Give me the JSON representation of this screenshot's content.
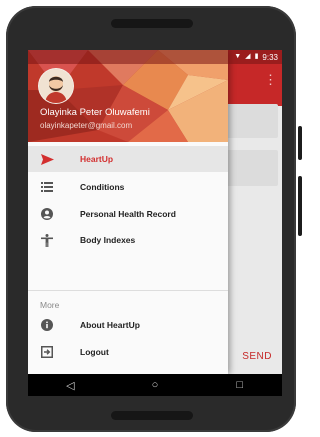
{
  "status_bar": {
    "time": "9:33"
  },
  "drawer": {
    "user_name": "Olayinka Peter Oluwafemi",
    "user_email": "olayinkapeter@gmail.com",
    "menu_items": [
      {
        "label": "HeartUp",
        "icon": "send-icon",
        "active": true
      },
      {
        "label": "Conditions",
        "icon": "list-icon",
        "active": false
      },
      {
        "label": "Personal Health Record",
        "icon": "account-circle-icon",
        "active": false
      },
      {
        "label": "Body Indexes",
        "icon": "accessibility-icon",
        "active": false
      }
    ],
    "section_label": "More",
    "more_items": [
      {
        "label": "About HeartUp",
        "icon": "info-icon"
      },
      {
        "label": "Logout",
        "icon": "logout-icon"
      }
    ]
  },
  "background_app": {
    "send_label": "SEND"
  },
  "colors": {
    "primary": "#c62828",
    "accent": "#d32f2f"
  }
}
